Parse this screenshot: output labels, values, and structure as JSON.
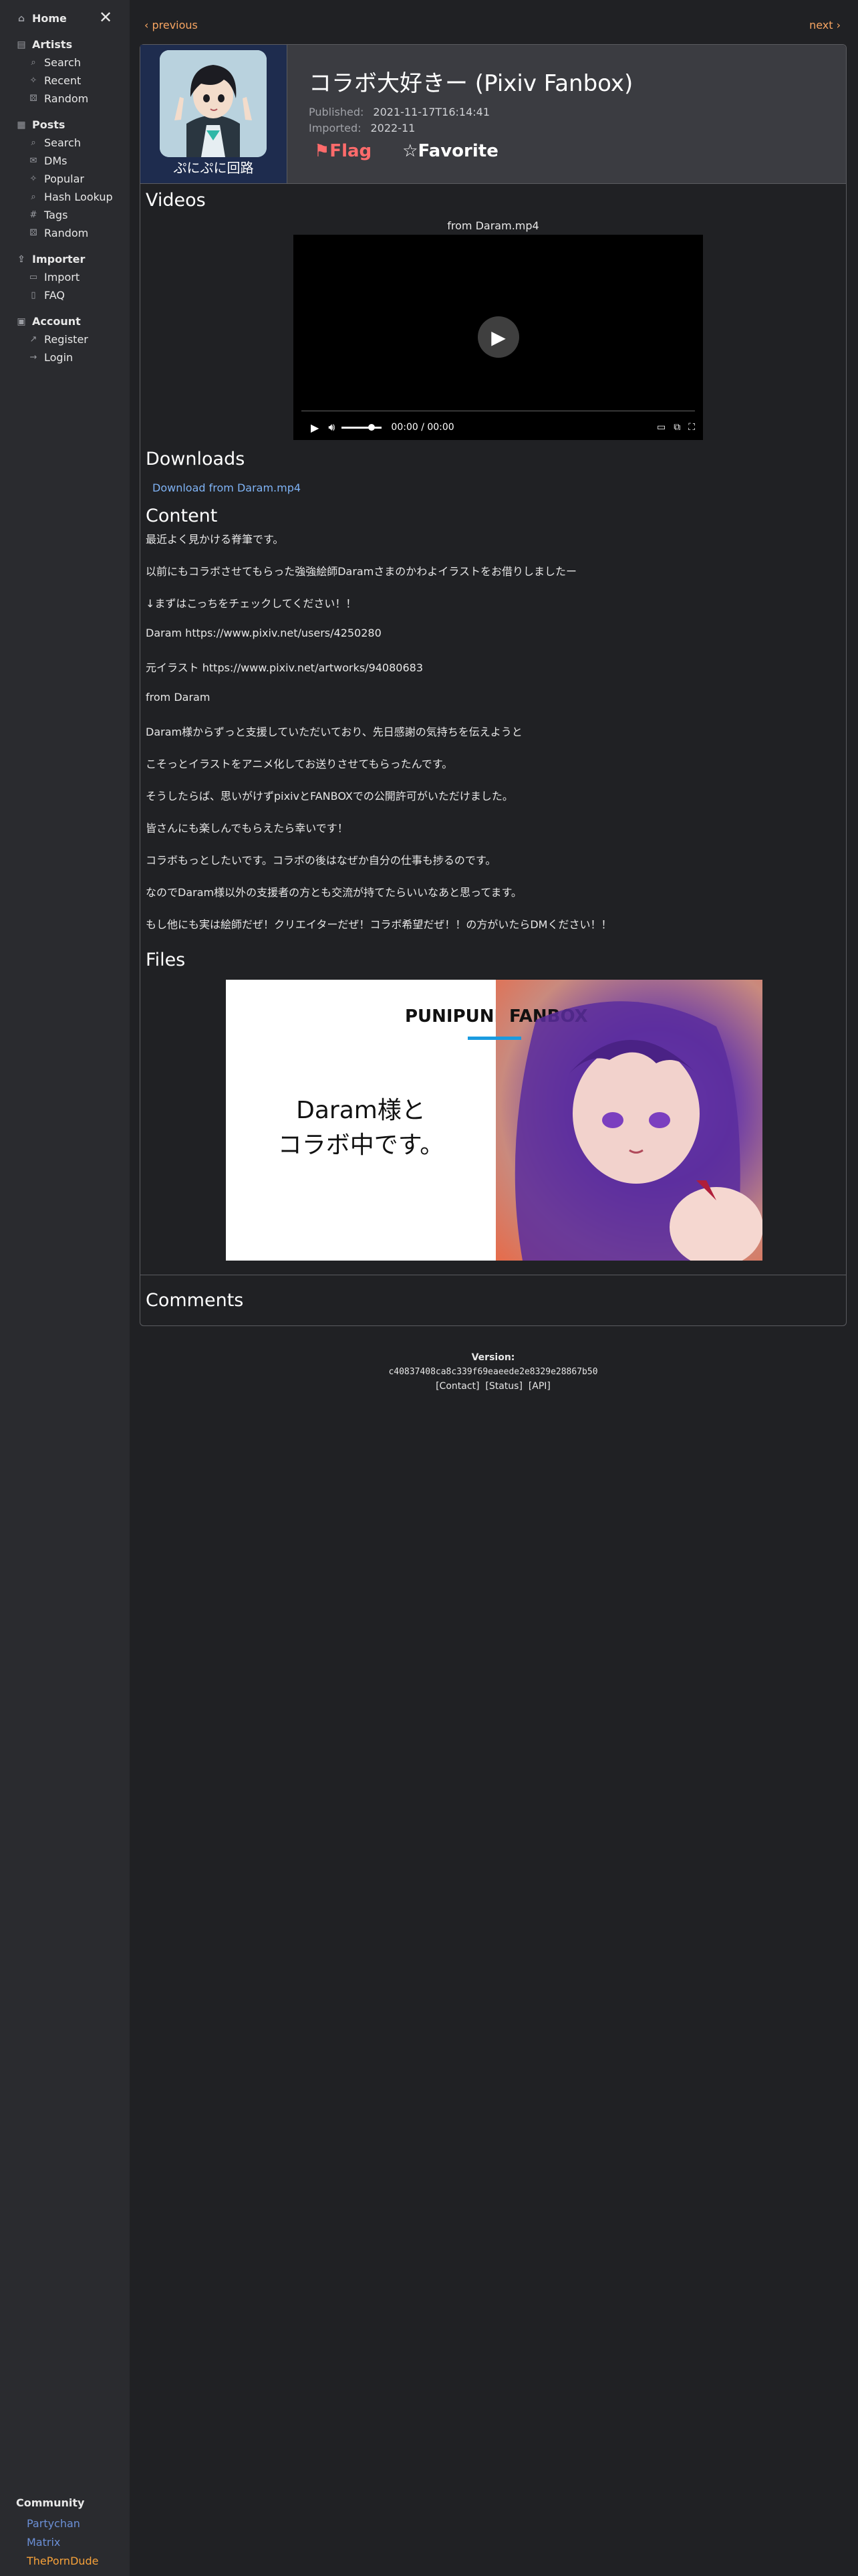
{
  "sidebar": {
    "home": "Home",
    "artists": {
      "title": "Artists",
      "items": [
        "Search",
        "Recent",
        "Random"
      ]
    },
    "posts": {
      "title": "Posts",
      "items": [
        "Search",
        "DMs",
        "Popular",
        "Hash Lookup",
        "Tags",
        "Random"
      ]
    },
    "importer": {
      "title": "Importer",
      "items": [
        "Import",
        "FAQ"
      ]
    },
    "account": {
      "title": "Account",
      "items": [
        "Register",
        "Login"
      ]
    },
    "community": {
      "title": "Community",
      "links": [
        {
          "label": "Partychan",
          "color": "#6b8fd6"
        },
        {
          "label": "Matrix",
          "color": "#6b8fd6"
        },
        {
          "label": "ThePornDude",
          "color": "#f7a23a"
        }
      ]
    }
  },
  "nav": {
    "previous": "‹ previous",
    "next": "next ›"
  },
  "post": {
    "artist_caption": "ぷにぷに回路",
    "title": "コラボ大好きー (Pixiv Fanbox)",
    "published_label": "Published:",
    "published": "2021-11-17T16:14:41",
    "imported_label": "Imported:",
    "imported": "2022-11",
    "flag": "⚑Flag",
    "favorite": "☆Favorite"
  },
  "videos": {
    "title": "Videos",
    "caption": "from Daram.mp4",
    "time": "00:00 / 00:00",
    "volume_level": 0.75
  },
  "downloads": {
    "title": "Downloads",
    "link": "Download from Daram.mp4"
  },
  "content": {
    "title": "Content",
    "paragraphs": [
      "最近よく見かける脊筆です。",
      "以前にもコラボさせてもらった強強絵師Daramさまのかわよイラストをお借りしましたー",
      "↓まずはこっちをチェックしてください！！",
      "Daram https://www.pixiv.net/users/4250280",
      "元イラスト https://www.pixiv.net/artworks/94080683",
      "from Daram",
      "Daram様からずっと支援していただいており、先日感謝の気持ちを伝えようと",
      "こそっとイラストをアニメ化してお送りさせてもらったんです。",
      "そうしたらば、思いがけずpixivとFANBOXでの公開許可がいただけました。",
      "皆さんにも楽しんでもらえたら幸いです！",
      "コラボもっとしたいです。コラボの後はなぜか自分の仕事も捗るのです。",
      "なのでDaram様以外の支援者の方とも交流が持てたらいいなあと思ってます。",
      "もし他にも実は絵師だぜ！クリエイターだぜ！コラボ希望だぜ！！の方がいたらDMください！！"
    ]
  },
  "files": {
    "title": "Files",
    "brand_left": "PUNIPUNI",
    "brand_right": "FANBOX",
    "big_line1": "Daram様と",
    "big_line2": "コラボ中です。"
  },
  "comments": {
    "title": "Comments"
  },
  "footer": {
    "version_label": "Version:",
    "hash": "c40837408ca8c339f69eaeede2e8329e28867b50",
    "links": "[Contact]  [Status]  [API]"
  }
}
